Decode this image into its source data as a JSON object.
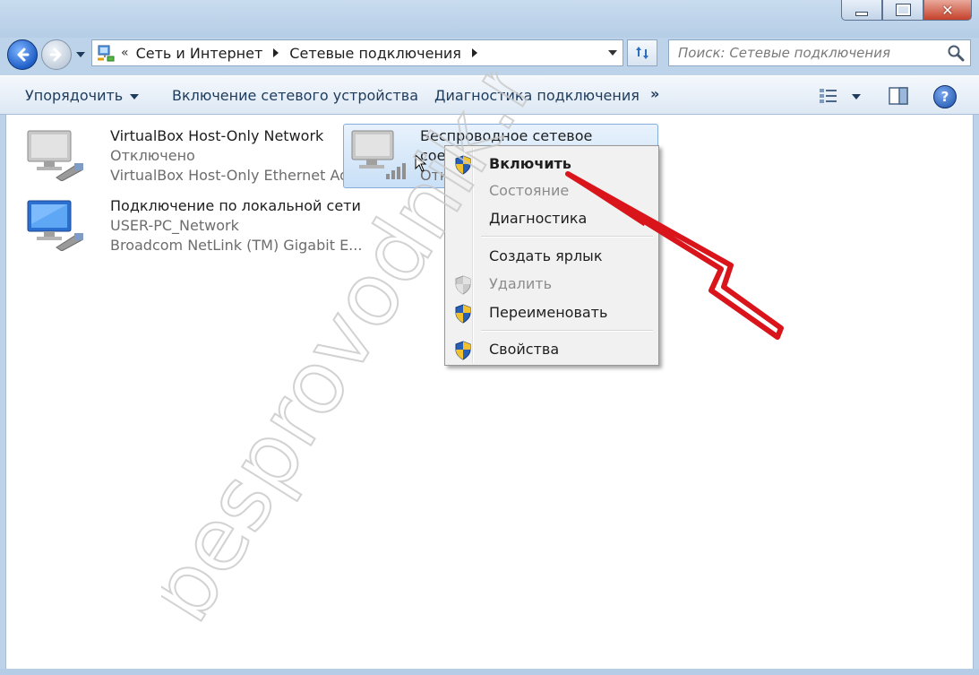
{
  "window": {
    "buttons": {
      "minimize": "minimize",
      "maximize": "maximize",
      "close": "close"
    }
  },
  "address": {
    "overflow": "«",
    "crumbs": [
      "Сеть и Интернет",
      "Сетевые подключения"
    ]
  },
  "search": {
    "placeholder": "Поиск: Сетевые подключения"
  },
  "commandbar": {
    "organize": "Упорядочить",
    "enable_device": "Включение сетевого устройства",
    "diagnose": "Диагностика подключения",
    "more": "»",
    "help": "?"
  },
  "connections": [
    {
      "name": "VirtualBox Host-Only Network",
      "status": "Отключено",
      "adapter": "VirtualBox Host-Only Ethernet Ad..."
    },
    {
      "name": "Подключение по локальной сети",
      "status": "USER-PC_Network",
      "adapter": "Broadcom NetLink (TM) Gigabit E..."
    },
    {
      "name": "Беспроводное сетевое",
      "name_line2": "соед",
      "status": "Откл"
    }
  ],
  "context_menu": {
    "items": [
      {
        "label": "Включить",
        "bold": true,
        "icon": "uac-shield-icon"
      },
      {
        "label": "Состояние",
        "disabled": true
      },
      {
        "label": "Диагностика"
      },
      {
        "label": "Создать ярлык"
      },
      {
        "label": "Удалить",
        "disabled": true,
        "icon": "uac-shield-icon"
      },
      {
        "label": "Переименовать",
        "icon": "uac-shield-icon"
      },
      {
        "label": "Свойства",
        "icon": "uac-shield-icon"
      }
    ]
  },
  "watermark": {
    "text": "besprovodnik.ru"
  },
  "colors": {
    "annotation_arrow": "#d9141b",
    "selection": "#c9e0f7",
    "accent": "#1f5fc7"
  }
}
